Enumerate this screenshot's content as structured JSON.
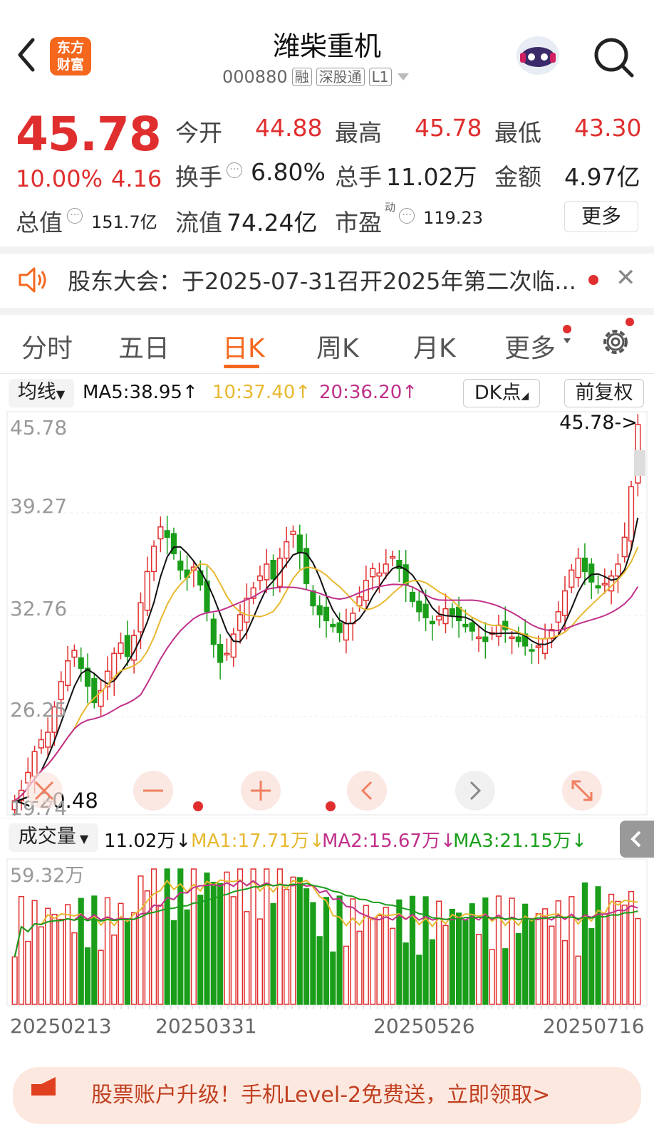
{
  "header": {
    "logo_line1": "东方",
    "logo_line2": "财富",
    "title": "潍柴重机",
    "code": "000880",
    "tags": [
      "融",
      "深股通",
      "L1"
    ]
  },
  "quote": {
    "price": "45.78",
    "change_pct": "10.00%",
    "change_abs": "4.16",
    "open_label": "今开",
    "open": "44.88",
    "high_label": "最高",
    "high": "45.78",
    "low_label": "最低",
    "low": "43.30",
    "turnover_label": "换手",
    "turnover": "6.80%",
    "volume_label": "总手",
    "volume": "11.02万",
    "amount_label": "金额",
    "amount": "4.97亿",
    "mktcap_label": "总值",
    "mktcap": "151.7亿",
    "float_label": "流值",
    "float": "74.24亿",
    "pe_label": "市盈",
    "pe_sup": "动",
    "pe": "119.23",
    "more": "更多"
  },
  "notice": {
    "text": "股东大会：于2025-07-31召开2025年第二次临..."
  },
  "tabs": [
    "分时",
    "五日",
    "日K",
    "周K",
    "月K",
    "更多"
  ],
  "active_tab": "日K",
  "kline_bar": {
    "indicator": "均线",
    "ma5": "MA5:38.95↑",
    "ma10": "10:37.40↑",
    "ma20": "20:36.20↑",
    "dk": "DK点",
    "adjust": "前复权"
  },
  "price_axis": {
    "labels": [
      "45.78",
      "39.27",
      "32.76",
      "26.25",
      "19.74"
    ],
    "last_marker": "45.78->",
    "low_marker": "<-20.48"
  },
  "volume_bar": {
    "indicator": "成交量",
    "vol": "11.02万↓",
    "ma1": "MA1:17.71万↓",
    "ma2": "MA2:15.67万↓",
    "ma3": "MA3:21.15万↓",
    "max_label": "59.32万"
  },
  "dates": [
    "20250213",
    "20250331",
    "20250526",
    "20250716"
  ],
  "banner": {
    "text": "股票账户升级！手机Level-2免费送，立即领取>"
  },
  "colors": {
    "up": "#e02e2e",
    "down": "#1a9e1a",
    "ma5": "#111111",
    "ma10": "#e8b830",
    "ma20": "#c0308a",
    "accent": "#f5671d"
  },
  "chart_data": {
    "type": "candlestick",
    "price_range": [
      19.74,
      45.78
    ],
    "ma_lines": {
      "ma5_last": 38.95,
      "ma10_last": 37.4,
      "ma20_last": 36.2
    },
    "volume_max": "59.32万"
  }
}
